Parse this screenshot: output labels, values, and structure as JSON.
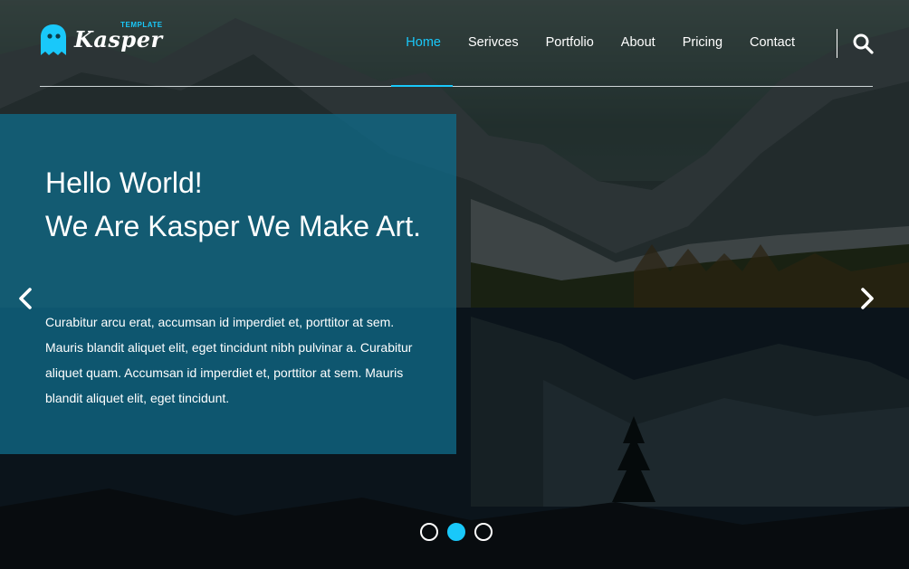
{
  "brand": {
    "name": "Kasper",
    "tagline": "TEMPLATE",
    "accent_color": "#19c8fa",
    "logo_icon": "ghost-icon"
  },
  "nav": {
    "items": [
      {
        "label": "Home",
        "active": true
      },
      {
        "label": "Serivces",
        "active": false
      },
      {
        "label": "Portfolio",
        "active": false
      },
      {
        "label": "About",
        "active": false
      },
      {
        "label": "Pricing",
        "active": false
      },
      {
        "label": "Contact",
        "active": false
      }
    ],
    "search_icon": "search-icon"
  },
  "hero": {
    "title_line1": "Hello World!",
    "title_line2": "We Are Kasper We Make Art.",
    "body": "Curabitur arcu erat, accumsan id imperdiet et, porttitor at sem. Mauris blandit aliquet elit, eget tincidunt nibh pulvinar a. Curabitur aliquet quam. Accumsan id imperdiet et, porttitor at sem. Mauris blandit aliquet elit, eget tincidunt.",
    "panel_color": "#106987",
    "prev_icon": "chevron-left-icon",
    "next_icon": "chevron-right-icon"
  },
  "slider": {
    "bullet_count": 3,
    "active_index": 1
  }
}
